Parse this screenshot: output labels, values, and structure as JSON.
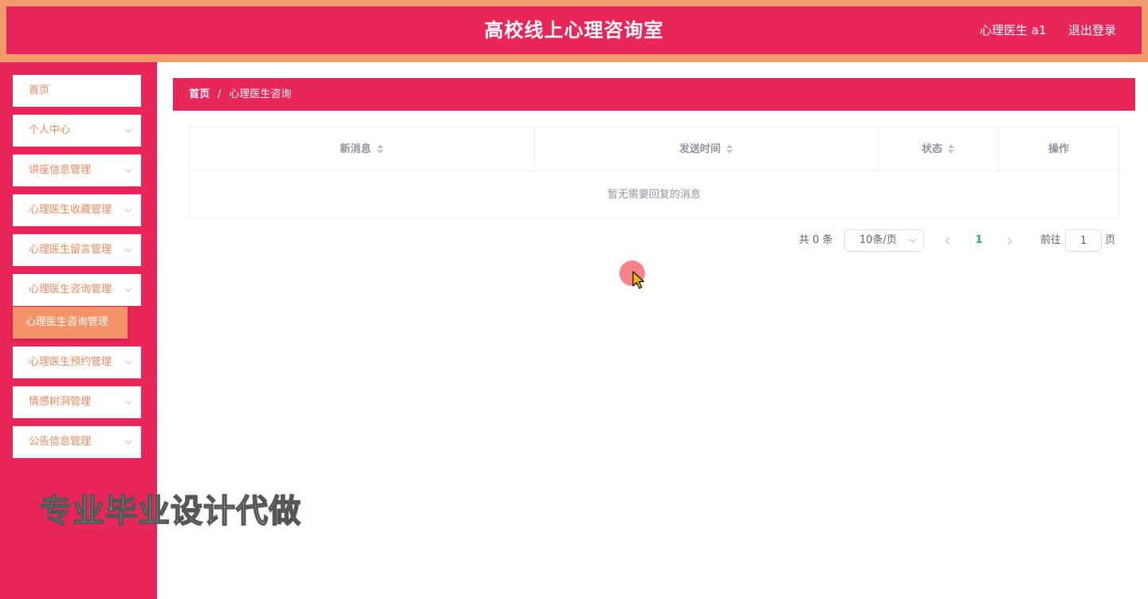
{
  "header": {
    "title": "高校线上心理咨询室",
    "user": "心理医生 a1",
    "logout": "退出登录"
  },
  "sidebar": {
    "items": [
      {
        "label": "首页",
        "has_children": false
      },
      {
        "label": "个人中心",
        "has_children": true
      },
      {
        "label": "讲座信息管理",
        "has_children": true
      },
      {
        "label": "心理医生收藏管理",
        "has_children": true
      },
      {
        "label": "心理医生留言管理",
        "has_children": true
      },
      {
        "label": "心理医生咨询管理",
        "has_children": true,
        "expanded": true
      },
      {
        "label": "心理医生预约管理",
        "has_children": true
      },
      {
        "label": "情感树洞管理",
        "has_children": true
      },
      {
        "label": "公告信息管理",
        "has_children": true
      }
    ],
    "active_subitem": "心理医生咨询管理"
  },
  "watermark": "专业毕业设计代做",
  "breadcrumb": {
    "home": "首页",
    "separator": "/",
    "current": "心理医生咨询"
  },
  "table": {
    "columns": [
      {
        "label": "新消息",
        "sortable": true
      },
      {
        "label": "发送时间",
        "sortable": true
      },
      {
        "label": "状态",
        "sortable": true
      },
      {
        "label": "操作",
        "sortable": false
      }
    ],
    "rows": [],
    "empty_text": "暂无需要回复的消息"
  },
  "pagination": {
    "total_label": "共 0 条",
    "page_size": "10条/页",
    "current_page": "1",
    "goto_label": "前往",
    "goto_value": "1",
    "goto_unit": "页"
  },
  "colors": {
    "primary": "#e8265a",
    "accent": "#f29a6c",
    "menu_text": "#f0885a",
    "active_page": "#21b27a"
  },
  "icons": {
    "chevron": "chevron-down-icon",
    "sort": "sort-icon",
    "prev": "chevron-left-icon",
    "next": "chevron-right-icon",
    "cursor": "mouse-cursor-icon"
  }
}
